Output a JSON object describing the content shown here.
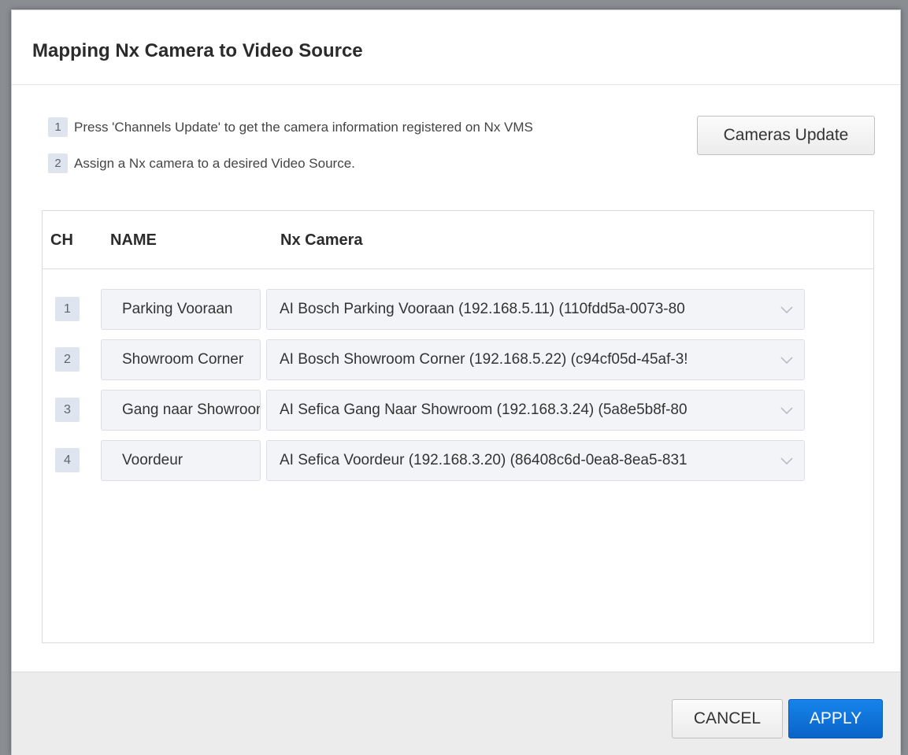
{
  "dialog": {
    "title": "Mapping Nx Camera to Video Source"
  },
  "steps": [
    {
      "num": "1",
      "text": "Press 'Channels Update' to get the camera information registered on Nx VMS"
    },
    {
      "num": "2",
      "text": "Assign a Nx camera to a desired Video Source."
    }
  ],
  "update_button": "Cameras Update",
  "table": {
    "headers": {
      "ch": "CH",
      "name": "NAME",
      "camera": "Nx Camera"
    },
    "rows": [
      {
        "ch": "1",
        "name": "Parking Vooraan",
        "camera": "AI Bosch Parking Vooraan (192.168.5.11) (110fdd5a-0073-80"
      },
      {
        "ch": "2",
        "name": "Showroom Corner",
        "camera": "AI Bosch Showroom Corner (192.168.5.22) (c94cf05d-45af-3!"
      },
      {
        "ch": "3",
        "name": "Gang naar Showroom",
        "camera": "AI Sefica Gang Naar Showroom (192.168.3.24) (5a8e5b8f-80"
      },
      {
        "ch": "4",
        "name": "Voordeur",
        "camera": "AI Sefica Voordeur (192.168.3.20) (86408c6d-0ea8-8ea5-831"
      }
    ]
  },
  "footer": {
    "cancel_label": "CANCEL",
    "apply_label": "APPLY"
  },
  "colors": {
    "accent": "#0a6fd6",
    "badge_bg": "#dfe5ee",
    "field_bg": "#f3f4f8"
  },
  "icons": {
    "select_arrow": "chevron-down-icon"
  }
}
